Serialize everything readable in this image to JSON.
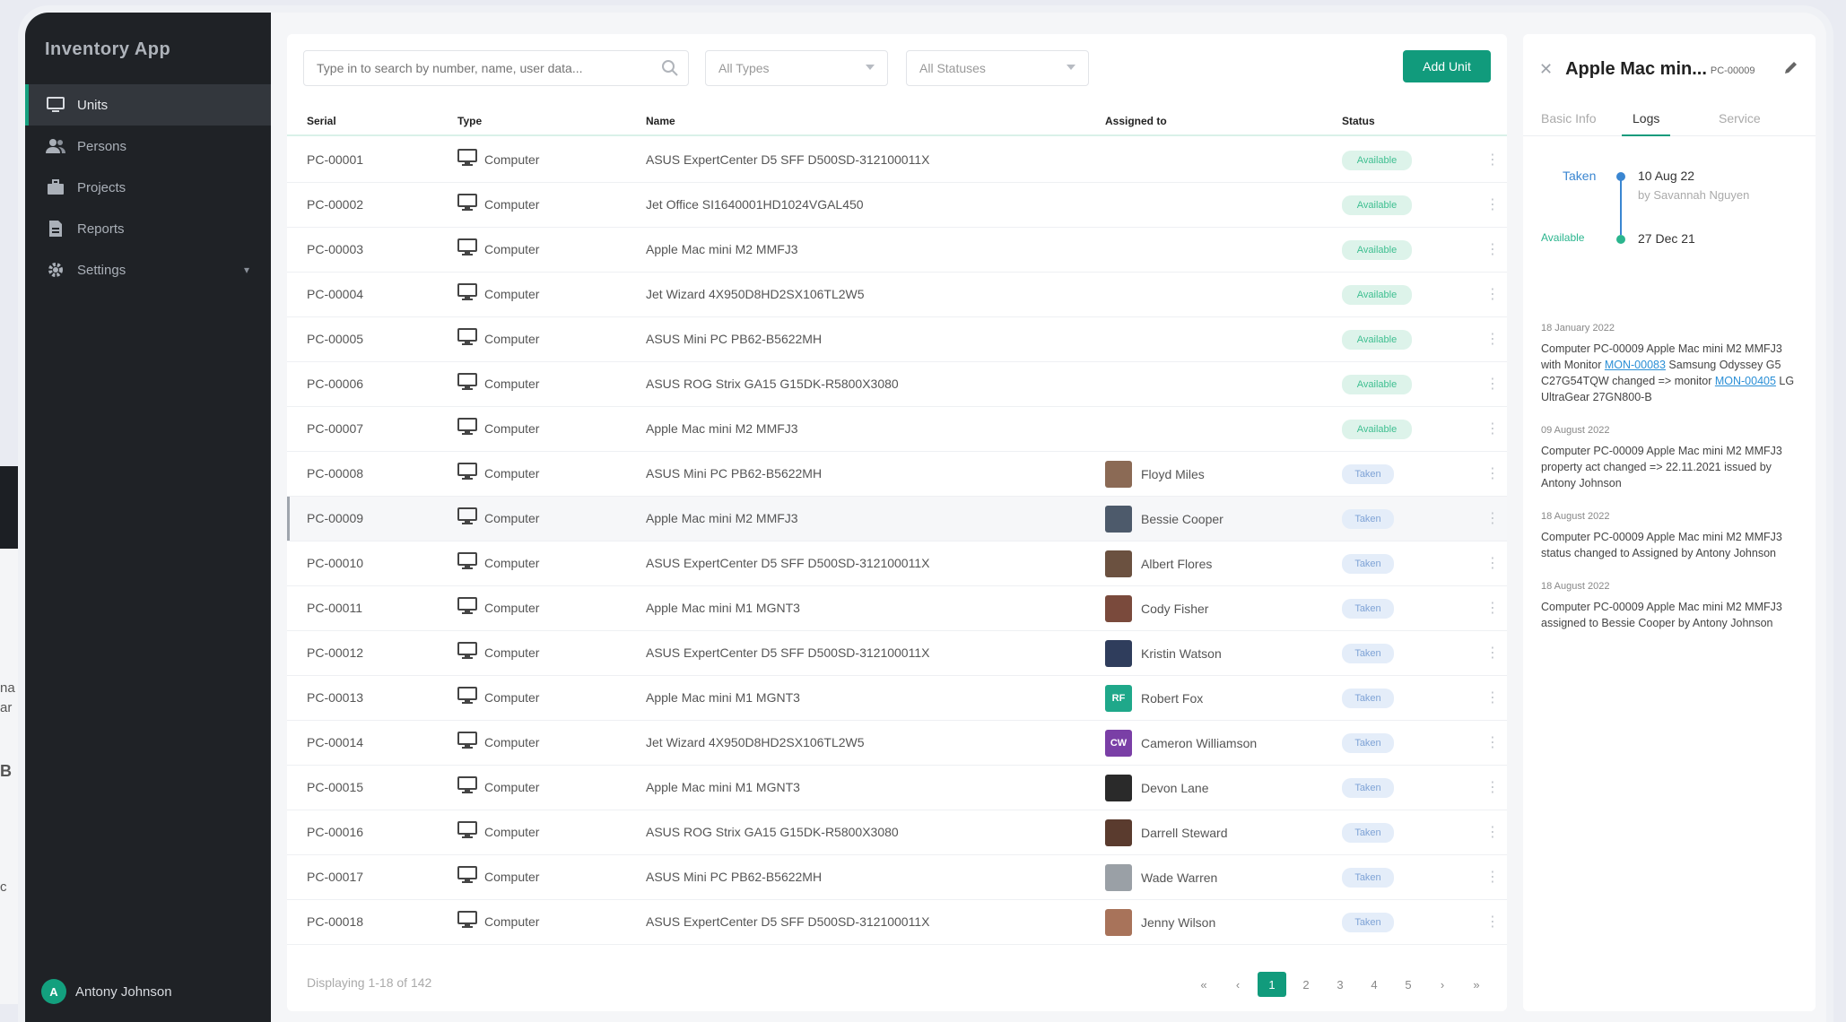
{
  "app": {
    "brand": "Inventory App"
  },
  "sidebar": {
    "items": [
      {
        "label": "Units",
        "icon": "monitor-icon",
        "active": true
      },
      {
        "label": "Persons",
        "icon": "people-icon",
        "active": false
      },
      {
        "label": "Projects",
        "icon": "briefcase-icon",
        "active": false
      },
      {
        "label": "Reports",
        "icon": "report-icon",
        "active": false
      },
      {
        "label": "Settings",
        "icon": "gear-icon",
        "active": false
      }
    ],
    "user": {
      "initial": "A",
      "name": "Antony Johnson"
    }
  },
  "toolbar": {
    "search_placeholder": "Type in to search by number, name, user data...",
    "type_filter": "All Types",
    "statuses_filter": "All Statuses",
    "add_label": "Add Unit"
  },
  "table": {
    "headers": {
      "serial": "Serial",
      "type": "Type",
      "name": "Name",
      "assigned": "Assigned to",
      "status": "Status"
    },
    "rows": [
      {
        "serial": "PC-00001",
        "type": "Computer",
        "name": "ASUS ExpertCenter D5 SFF D500SD-312100011X",
        "assigned": "",
        "status": "Available",
        "face": ""
      },
      {
        "serial": "PC-00002",
        "type": "Computer",
        "name": "Jet Office SI1640001HD1024VGAL450",
        "assigned": "",
        "status": "Available",
        "face": ""
      },
      {
        "serial": "PC-00003",
        "type": "Computer",
        "name": "Apple Mac mini M2 MMFJ3",
        "assigned": "",
        "status": "Available",
        "face": ""
      },
      {
        "serial": "PC-00004",
        "type": "Computer",
        "name": "Jet Wizard 4X950D8HD2SX106TL2W5",
        "assigned": "",
        "status": "Available",
        "face": ""
      },
      {
        "serial": "PC-00005",
        "type": "Computer",
        "name": "ASUS Mini PC PB62-B5622MH",
        "assigned": "",
        "status": "Available",
        "face": ""
      },
      {
        "serial": "PC-00006",
        "type": "Computer",
        "name": "ASUS ROG Strix GA15 G15DK-R5800X3080",
        "assigned": "",
        "status": "Available",
        "face": ""
      },
      {
        "serial": "PC-00007",
        "type": "Computer",
        "name": "Apple Mac mini M2 MMFJ3",
        "assigned": "",
        "status": "Available",
        "face": ""
      },
      {
        "serial": "PC-00008",
        "type": "Computer",
        "name": "ASUS Mini PC PB62-B5622MH",
        "assigned": "Floyd Miles",
        "status": "Taken",
        "face": "#8b6a55"
      },
      {
        "serial": "PC-00009",
        "type": "Computer",
        "name": "Apple Mac mini M2 MMFJ3",
        "assigned": "Bessie Cooper",
        "status": "Taken",
        "face": "#4d5a6b",
        "selected": true
      },
      {
        "serial": "PC-00010",
        "type": "Computer",
        "name": "ASUS ExpertCenter D5 SFF D500SD-312100011X",
        "assigned": "Albert Flores",
        "status": "Taken",
        "face": "#6b5140"
      },
      {
        "serial": "PC-00011",
        "type": "Computer",
        "name": "Apple Mac mini M1 MGNT3",
        "assigned": "Cody Fisher",
        "status": "Taken",
        "face": "#7a4a3c"
      },
      {
        "serial": "PC-00012",
        "type": "Computer",
        "name": "ASUS ExpertCenter D5 SFF D500SD-312100011X",
        "assigned": "Kristin Watson",
        "status": "Taken",
        "face": "#2f3d5c"
      },
      {
        "serial": "PC-00013",
        "type": "Computer",
        "name": "Apple Mac mini M1 MGNT3",
        "assigned": "Robert Fox",
        "status": "Taken",
        "face": "#1fa88a",
        "initials": "RF"
      },
      {
        "serial": "PC-00014",
        "type": "Computer",
        "name": "Jet Wizard 4X950D8HD2SX106TL2W5",
        "assigned": "Cameron Williamson",
        "status": "Taken",
        "face": "#7a3fa6",
        "initials": "CW"
      },
      {
        "serial": "PC-00015",
        "type": "Computer",
        "name": "Apple Mac mini M1 MGNT3",
        "assigned": "Devon Lane",
        "status": "Taken",
        "face": "#2a2a2a"
      },
      {
        "serial": "PC-00016",
        "type": "Computer",
        "name": "ASUS ROG Strix GA15 G15DK-R5800X3080",
        "assigned": "Darrell Steward",
        "status": "Taken",
        "face": "#5a3b2e"
      },
      {
        "serial": "PC-00017",
        "type": "Computer",
        "name": "ASUS Mini PC PB62-B5622MH",
        "assigned": "Wade Warren",
        "status": "Taken",
        "face": "#9aa0a6"
      },
      {
        "serial": "PC-00018",
        "type": "Computer",
        "name": "ASUS ExpertCenter D5 SFF D500SD-312100011X",
        "assigned": "Jenny Wilson",
        "status": "Taken",
        "face": "#a8735a"
      }
    ]
  },
  "footer": {
    "showing": "Displaying 1-18 of 142",
    "pages": [
      "«",
      "‹",
      "1",
      "2",
      "3",
      "4",
      "5",
      "›",
      "»"
    ],
    "active_page": "1"
  },
  "detail": {
    "title": "Apple Mac min...",
    "serial": "PC-00009",
    "tabs": [
      "Basic Info",
      "Logs",
      "Service"
    ],
    "active_tab": "Logs",
    "timeline": [
      {
        "status": "Taken",
        "date": "10 Aug 22",
        "by": "by Savannah Nguyen",
        "color": "#3a86d1"
      },
      {
        "status": "Available",
        "date": "27 Dec 21",
        "by": "",
        "color": "#2bb58e"
      }
    ],
    "logs": [
      {
        "date": "18 January 2022",
        "pre": "Computer PC-00009 Apple Mac mini M2 MMFJ3 with Monitor ",
        "link1": "MON-00083",
        "mid": " Samsung Odyssey G5 C27G54TQW changed => monitor ",
        "link2": "MON-00405",
        "post": " LG UltraGear 27GN800-B"
      },
      {
        "date": "09 August 2022",
        "pre": "Computer PC-00009 Apple Mac mini M2 MMFJ3 property act changed => 22.11.2021 issued by Antony Johnson",
        "link1": "",
        "mid": "",
        "link2": "",
        "post": ""
      },
      {
        "date": "18 August 2022",
        "pre": "Computer PC-00009 Apple Mac mini M2 MMFJ3 status changed to Assigned by Antony Johnson",
        "link1": "",
        "mid": "",
        "link2": "",
        "post": ""
      },
      {
        "date": "18 August 2022",
        "pre": "Computer PC-00009 Apple Mac mini M2 MMFJ3 assigned to Bessie Cooper by Antony Johnson",
        "link1": "",
        "mid": "",
        "link2": "",
        "post": ""
      }
    ]
  },
  "background": {
    "text_lines": [
      "na",
      "ar",
      "B",
      "c"
    ]
  }
}
